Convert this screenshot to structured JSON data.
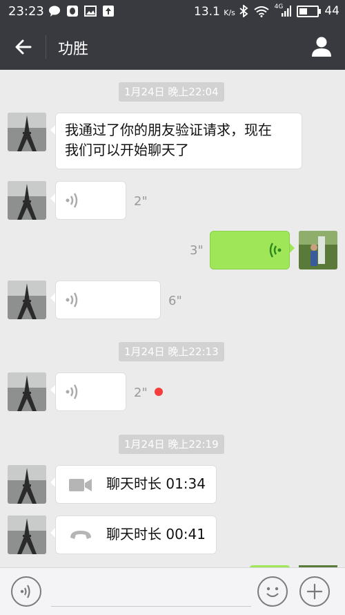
{
  "status_bar": {
    "time": "23:23",
    "speed": "13.1",
    "speed_unit": "K/s",
    "network": "4G",
    "battery_level": "44",
    "battery_fraction": 0.44
  },
  "header": {
    "title": "功胜",
    "back_icon": "arrow-left-icon",
    "profile_icon": "person-icon"
  },
  "chat": {
    "timestamps": [
      "1月24日 晚上22:04",
      "1月24日 晚上22:13",
      "1月24日 晚上22:19"
    ],
    "messages": [
      {
        "side": "left",
        "type": "text",
        "text_line1": "我通过了你的朋友验证请求，现在",
        "text_line2": "我们可以开始聊天了"
      },
      {
        "side": "left",
        "type": "voice",
        "duration": "2\""
      },
      {
        "side": "right",
        "type": "voice",
        "duration": "3\""
      },
      {
        "side": "left",
        "type": "voice",
        "duration": "6\""
      },
      {
        "side": "left",
        "type": "voice",
        "duration": "2\"",
        "unread": true
      },
      {
        "side": "left",
        "type": "video-call",
        "label": "聊天时长 01:34"
      },
      {
        "side": "left",
        "type": "voice-call",
        "label": "聊天时长 00:41"
      }
    ]
  },
  "colors": {
    "header_bg": "#393a3f",
    "chat_bg": "#ebebeb",
    "my_bubble": "#9fe658",
    "unread": "#f43d3d"
  }
}
